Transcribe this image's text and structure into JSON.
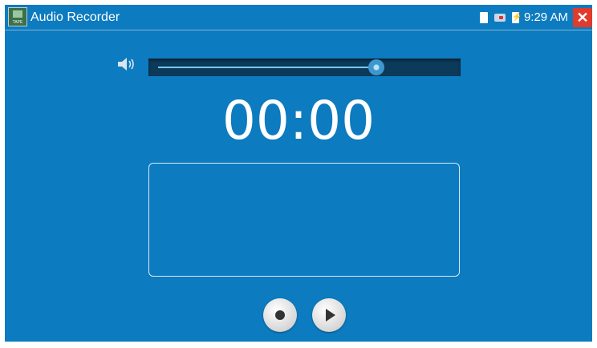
{
  "app": {
    "title": "Audio Recorder",
    "icon_label": "TAPE"
  },
  "status_bar": {
    "time": "9:29 AM",
    "icons": [
      "sd-card-icon",
      "usb-icon",
      "battery-charging-icon"
    ]
  },
  "volume": {
    "level": 0.73
  },
  "recorder": {
    "timer": "00:00"
  },
  "controls": {
    "record_icon": "record-icon",
    "play_icon": "play-icon"
  },
  "colors": {
    "background": "#0c7bbf",
    "close": "#e03b2c",
    "track": "#0c3a5a"
  }
}
